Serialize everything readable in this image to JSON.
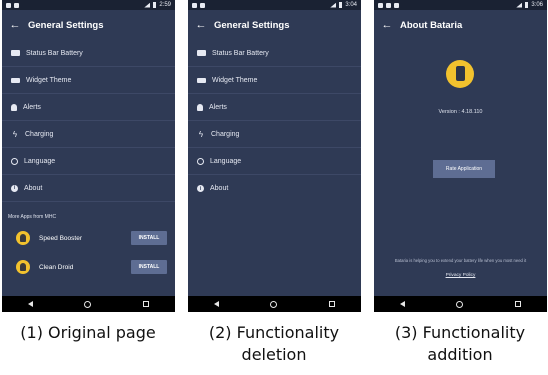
{
  "screens": [
    {
      "status_time": "2:59",
      "title": "General Settings",
      "menu": [
        {
          "label": "Status Bar Battery",
          "icon": "battery-icon"
        },
        {
          "label": "Widget Theme",
          "icon": "widget-icon"
        },
        {
          "label": "Alerts",
          "icon": "bell-icon"
        },
        {
          "label": "Charging",
          "icon": "bolt-icon"
        },
        {
          "label": "Language",
          "icon": "globe-icon"
        },
        {
          "label": "About",
          "icon": "info-icon"
        }
      ],
      "more_apps_label": "More Apps from MHC",
      "apps": [
        {
          "name": "Speed Booster",
          "button": "INSTALL"
        },
        {
          "name": "Clean Droid",
          "button": "INSTALL"
        }
      ]
    },
    {
      "status_time": "3:04",
      "title": "General Settings",
      "menu": [
        {
          "label": "Status Bar Battery",
          "icon": "battery-icon"
        },
        {
          "label": "Widget Theme",
          "icon": "widget-icon"
        },
        {
          "label": "Alerts",
          "icon": "bell-icon"
        },
        {
          "label": "Charging",
          "icon": "bolt-icon"
        },
        {
          "label": "Language",
          "icon": "globe-icon"
        },
        {
          "label": "About",
          "icon": "info-icon"
        }
      ]
    },
    {
      "status_time": "3:06",
      "title": "About Bataria",
      "version": "Version : 4.18.110",
      "rate_button": "Rate Application",
      "message": "Bataria is helping you to extend your battery life when you most need it",
      "privacy": "Privacy Policy"
    }
  ],
  "captions": [
    "(1) Original page",
    "(2) Functionality deletion",
    "(3) Functionality addition"
  ],
  "colors": {
    "background": "#2f3a55",
    "accent": "#f2c22e",
    "button": "#5e6d93"
  }
}
